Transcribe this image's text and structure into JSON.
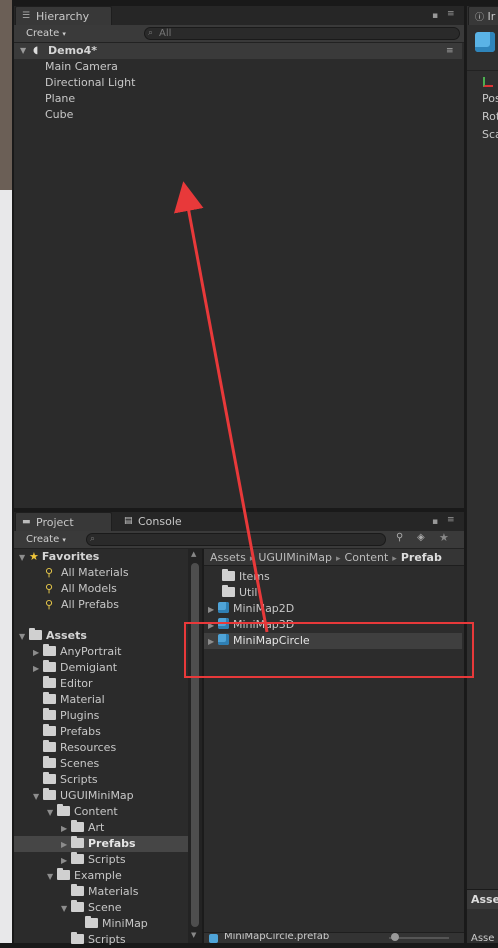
{
  "hierarchy": {
    "tab_label": "Hierarchy",
    "create_label": "Create",
    "search_placeholder": "All",
    "scene_name": "Demo4*",
    "items": [
      "Main Camera",
      "Directional Light",
      "Plane",
      "Cube"
    ]
  },
  "inspector": {
    "tab_label": "Ir",
    "rows": [
      "Pos",
      "Rot",
      "Sca"
    ],
    "footer_label": "Asse",
    "footer2_label": "Asse"
  },
  "project": {
    "tab_label": "Project",
    "console_tab_label": "Console",
    "create_label": "Create",
    "favorites": {
      "label": "Favorites",
      "items": [
        "All Materials",
        "All Models",
        "All Prefabs"
      ]
    },
    "assets_root": "Assets",
    "tree": [
      {
        "label": "AnyPortrait",
        "level": 1,
        "arrow": "▶"
      },
      {
        "label": "Demigiant",
        "level": 1,
        "arrow": "▶"
      },
      {
        "label": "Editor",
        "level": 1,
        "arrow": ""
      },
      {
        "label": "Material",
        "level": 1,
        "arrow": ""
      },
      {
        "label": "Plugins",
        "level": 1,
        "arrow": ""
      },
      {
        "label": "Prefabs",
        "level": 1,
        "arrow": ""
      },
      {
        "label": "Resources",
        "level": 1,
        "arrow": ""
      },
      {
        "label": "Scenes",
        "level": 1,
        "arrow": ""
      },
      {
        "label": "Scripts",
        "level": 1,
        "arrow": ""
      },
      {
        "label": "UGUIMiniMap",
        "level": 1,
        "arrow": "▼"
      },
      {
        "label": "Content",
        "level": 2,
        "arrow": "▼"
      },
      {
        "label": "Art",
        "level": 3,
        "arrow": "▶"
      },
      {
        "label": "Prefabs",
        "level": 3,
        "arrow": "▶",
        "selected": true
      },
      {
        "label": "Scripts",
        "level": 3,
        "arrow": "▶"
      },
      {
        "label": "Example",
        "level": 2,
        "arrow": "▼"
      },
      {
        "label": "Materials",
        "level": 3,
        "arrow": ""
      },
      {
        "label": "Scene",
        "level": 3,
        "arrow": "▼"
      },
      {
        "label": "MiniMap",
        "level": 4,
        "arrow": ""
      },
      {
        "label": "Scripts",
        "level": 3,
        "arrow": ""
      }
    ],
    "breadcrumb": [
      "Assets",
      "UGUIMiniMap",
      "Content",
      "Prefab"
    ],
    "breadcrumb_sep": "▸",
    "files": [
      {
        "label": "Items",
        "kind": "folder"
      },
      {
        "label": "Util",
        "kind": "folder"
      },
      {
        "label": "MiniMap2D",
        "kind": "prefab"
      },
      {
        "label": "MiniMap3D",
        "kind": "prefab"
      },
      {
        "label": "MiniMapCircle",
        "kind": "prefab",
        "highlighted": true
      }
    ],
    "status_file": "MiniMapCircle.prefab"
  },
  "annotation": {
    "arrow_color": "#e8393a",
    "box_color": "#e8393a"
  }
}
